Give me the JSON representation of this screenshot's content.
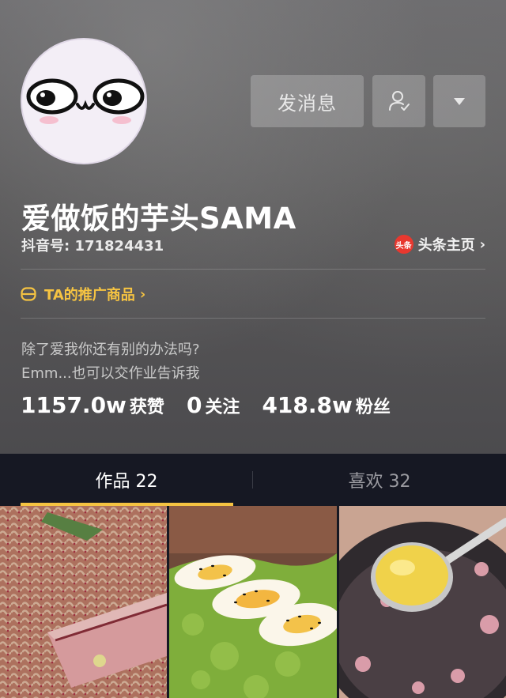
{
  "header": {
    "actions": {
      "message_label": "发消息",
      "follow_icon": "user-check-icon",
      "more_icon": "triangle-down-icon"
    },
    "display_name": "爱做饭的芋头SAMA",
    "douyin_id": "抖音号: 171824431",
    "toutiao": {
      "badge": "头条",
      "label": "头条主页"
    },
    "promo_label": "TA的推广商品",
    "bio": [
      "除了爱我你还有别的办法吗?",
      "Emm...也可以交作业告诉我"
    ],
    "stats": [
      {
        "value": "1157.0w",
        "label": "获赞"
      },
      {
        "value": "0",
        "label": "关注"
      },
      {
        "value": "418.8w",
        "label": "粉丝"
      }
    ]
  },
  "tabs": [
    {
      "label": "作品 22",
      "active": true
    },
    {
      "label": "喜欢 32",
      "active": false
    }
  ],
  "colors": {
    "accent": "#f5c342",
    "background": "#161823",
    "toutiao_red": "#e8382f"
  }
}
